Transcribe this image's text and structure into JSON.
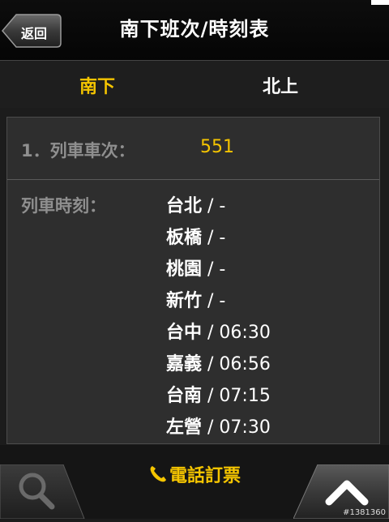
{
  "header": {
    "back_label": "返回",
    "title": "南下班次/時刻表"
  },
  "tabs": [
    {
      "label": "南下",
      "active": true
    },
    {
      "label": "北上",
      "active": false
    }
  ],
  "train": {
    "label": "1．列車車次：",
    "number": "551"
  },
  "schedule": {
    "label": "列車時刻：",
    "stops": [
      {
        "station": "台北",
        "time": "-"
      },
      {
        "station": "板橋",
        "time": "-"
      },
      {
        "station": "桃園",
        "time": "-"
      },
      {
        "station": "新竹",
        "time": "-"
      },
      {
        "station": "台中",
        "time": "06:30"
      },
      {
        "station": "嘉義",
        "time": "06:56"
      },
      {
        "station": "台南",
        "time": "07:15"
      },
      {
        "station": "左營",
        "time": "07:30"
      }
    ]
  },
  "bottom": {
    "phone_booking_label": "電話訂票"
  },
  "watermark": "#1381360",
  "colors": {
    "accent": "#f5c500",
    "background": "#1c1c1c",
    "card": "#2e2e2e",
    "label_gray": "#8f8f8f"
  },
  "icons": {
    "back": "back-arrow-icon",
    "phone": "phone-icon",
    "search": "search-icon",
    "up": "chevron-up-icon"
  }
}
